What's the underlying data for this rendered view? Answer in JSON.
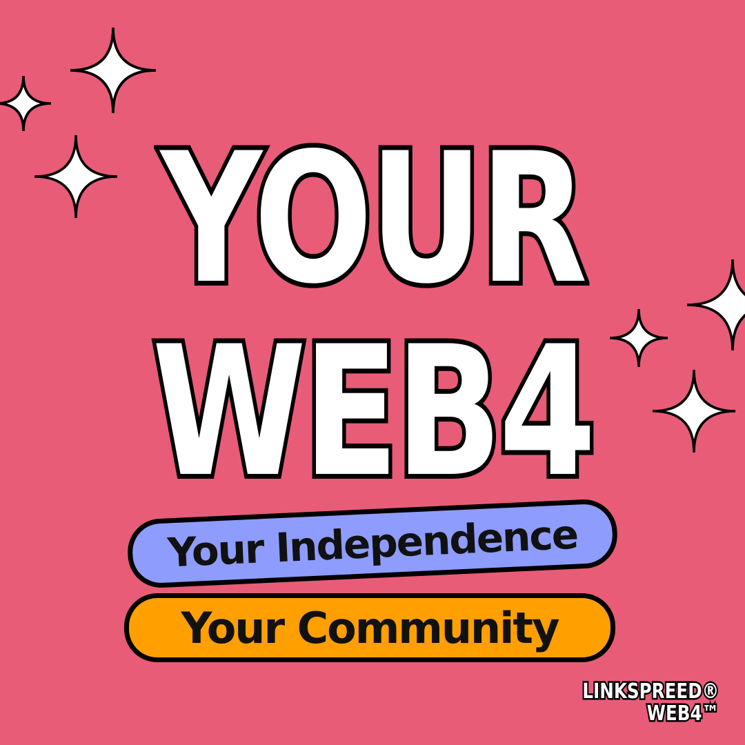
{
  "headline": {
    "line_1": "YOUR",
    "line_2": "WEB4"
  },
  "pills": {
    "independence": "Your Independence",
    "community": "Your Community"
  },
  "brand": {
    "line_1": "LINKSPREED®",
    "line_2": "WEB4™"
  },
  "colors": {
    "background": "#E85C78",
    "pill_blue": "#8E9CFD",
    "pill_orange": "#FFA000",
    "text_white": "#FFFFFF",
    "outline": "#000000"
  },
  "icons": [
    "sparkle-icon"
  ]
}
